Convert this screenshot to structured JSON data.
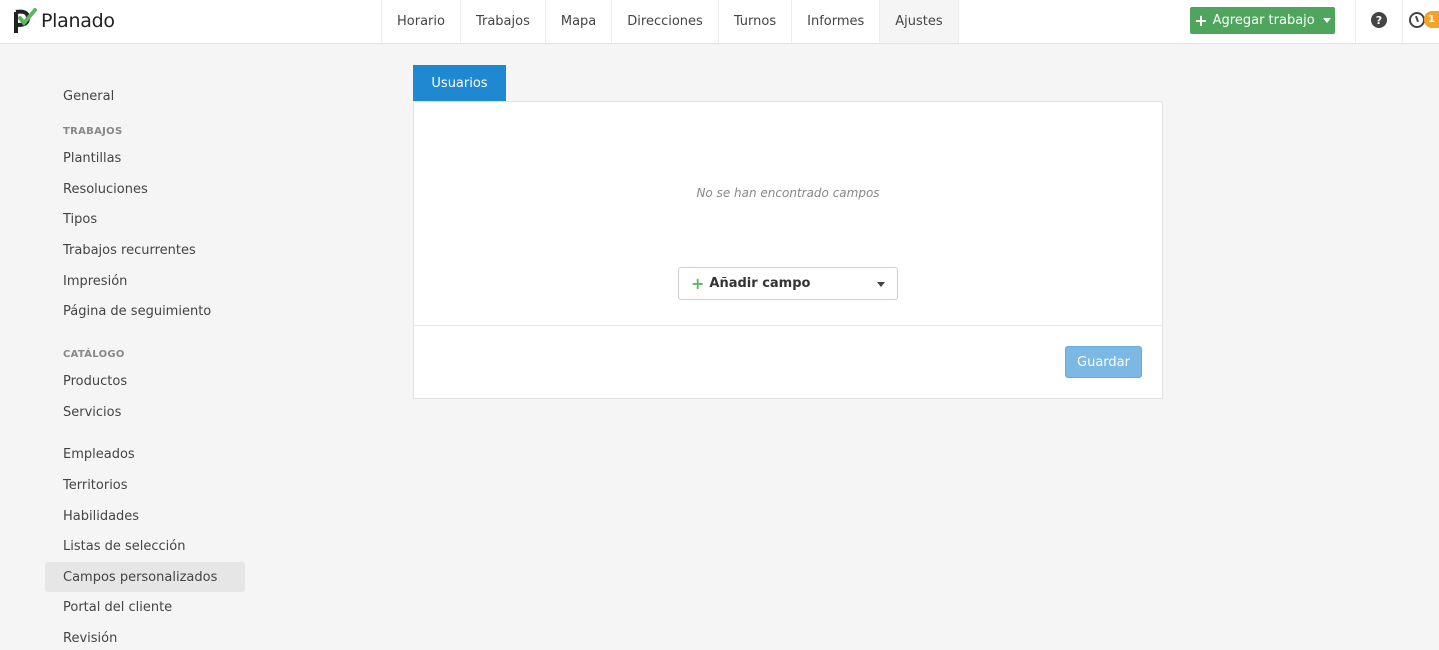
{
  "app": {
    "name": "Planado"
  },
  "nav": {
    "items": [
      {
        "label": "Horario"
      },
      {
        "label": "Trabajos"
      },
      {
        "label": "Mapa"
      },
      {
        "label": "Direcciones"
      },
      {
        "label": "Turnos"
      },
      {
        "label": "Informes"
      },
      {
        "label": "Ajustes",
        "active": true
      }
    ]
  },
  "toolbar": {
    "add_job_label": "Agregar trabajo",
    "help_icon": "?",
    "notification_count": "1"
  },
  "sidebar": {
    "general": "General",
    "trabajos_header": "TRABAJOS",
    "trabajos": [
      "Plantillas",
      "Resoluciones",
      "Tipos",
      "Trabajos recurrentes",
      "Impresión",
      "Página de seguimiento"
    ],
    "catalogo_header": "CATÁLOGO",
    "catalogo": [
      "Productos",
      "Servicios"
    ],
    "other": [
      "Empleados",
      "Territorios",
      "Habilidades",
      "Listas de selección",
      "Campos personalizados",
      "Portal del cliente",
      "Revisión"
    ],
    "active_item": "Campos personalizados"
  },
  "main": {
    "tab_label": "Usuarios",
    "empty_message": "No se han encontrado campos",
    "add_field_label": "Añadir campo",
    "save_label": "Guardar"
  },
  "colors": {
    "brand_green": "#4ea55b",
    "tab_blue": "#1e88d0",
    "save_blue": "#7bb8e3",
    "badge_orange": "#f2a42a"
  }
}
